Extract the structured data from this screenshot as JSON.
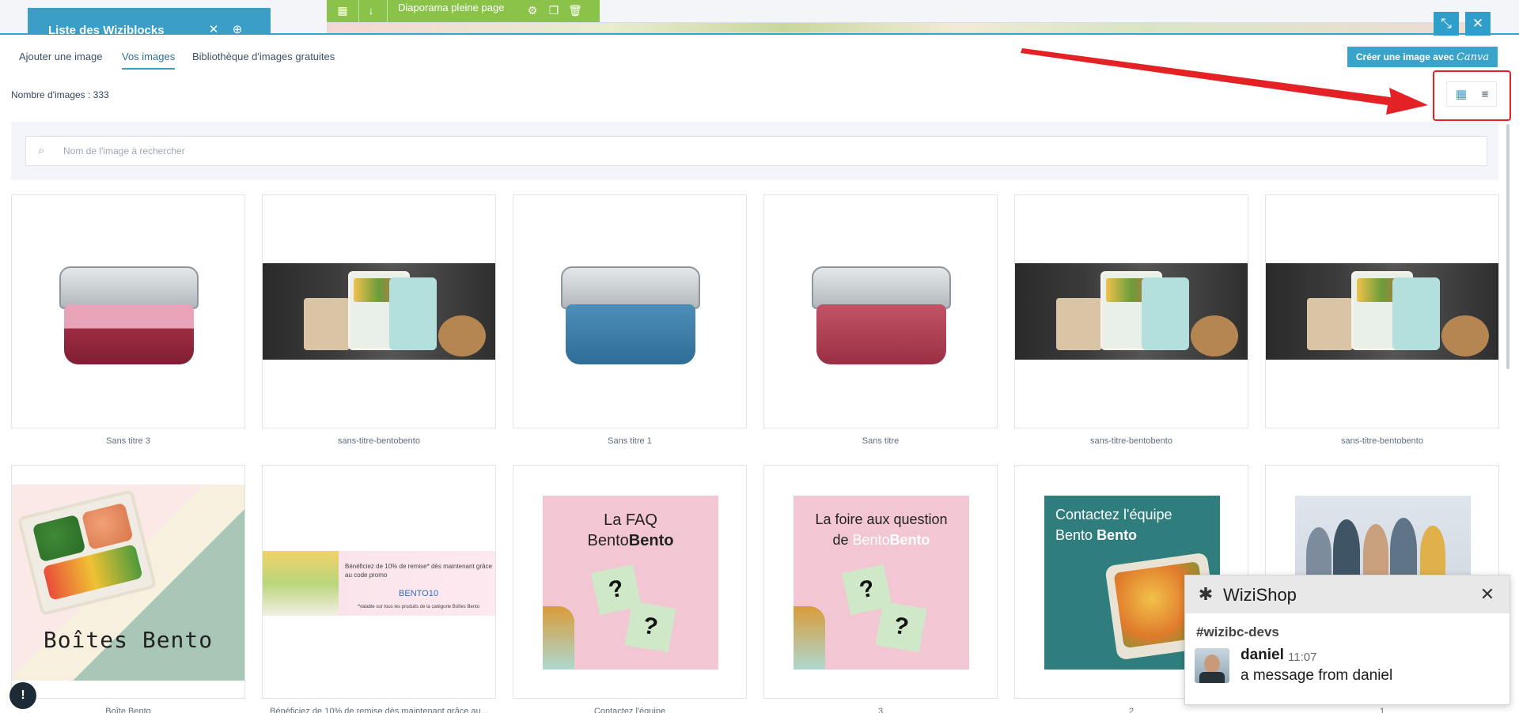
{
  "editor": {
    "wiziblocks_title": "Liste des Wiziblocks",
    "block_label": "Diaporama pleine page"
  },
  "tabs": [
    {
      "label": "Ajouter une image",
      "active": false
    },
    {
      "label": "Vos images",
      "active": true
    },
    {
      "label": "Bibliothèque d'images gratuites",
      "active": false
    }
  ],
  "canva_button": {
    "label": "Créer une image avec",
    "brand": "Canva"
  },
  "image_count": "Nombre d'images : 333",
  "search": {
    "placeholder": "Nom de l'image à rechercher",
    "value": ""
  },
  "view_toggle": {
    "active": "grid"
  },
  "images": [
    {
      "caption": "Sans titre 3",
      "art": "lunchbox-pink"
    },
    {
      "caption": "sans-titre-bentobento",
      "art": "kitchen"
    },
    {
      "caption": "Sans titre 1",
      "art": "lunchbox-blue"
    },
    {
      "caption": "Sans titre",
      "art": "lunchbox-red"
    },
    {
      "caption": "sans-titre-bentobento",
      "art": "kitchen"
    },
    {
      "caption": "sans-titre-bentobento",
      "art": "kitchen"
    },
    {
      "caption": "Boîte Bento",
      "art": "bento",
      "title": "Boîtes Bento"
    },
    {
      "caption": "Bénéficiez de 10% de remise dès maintenant grâce au...",
      "art": "promo",
      "text": "Bénéficiez de 10% de remise* dès maintenant grâce au code promo",
      "code": "BENTO10",
      "note": "*Valable sur tous les produits de la catégorie Boîtes Bento"
    },
    {
      "caption": "Contactez l'équipe",
      "art": "faq",
      "line1": "La FAQ",
      "line2a": "Bento",
      "line2b": "Bento"
    },
    {
      "caption": "3",
      "art": "faq2",
      "line1": "La foire aux question",
      "line2a": "de",
      "line2b": "Bento",
      "line2c": "Bento"
    },
    {
      "caption": "2",
      "art": "contact",
      "line1": "Contactez l'équipe",
      "line2a": "Bento",
      "line2b": "Bento"
    },
    {
      "caption": "1",
      "art": "team"
    }
  ],
  "chat": {
    "brand": "WiziShop",
    "channel": "#wizibc-devs",
    "user": "daniel",
    "time": "11:07",
    "message": "a message from daniel"
  },
  "colors": {
    "accent": "#3aa3c9",
    "annotation": "#e42226",
    "editor_bar": "#8bc34a"
  }
}
